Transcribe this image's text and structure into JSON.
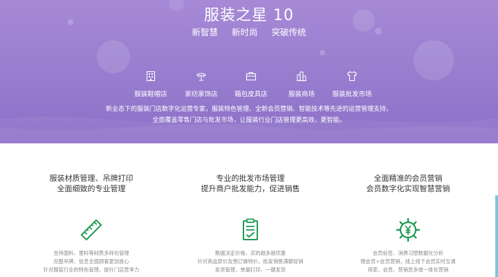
{
  "hero": {
    "title": "服装之星 10",
    "subtitle": [
      "新智慧",
      "新时尚",
      "突破传统"
    ],
    "stores": [
      {
        "label": "服装鞋帽店",
        "icon": "building-icon"
      },
      {
        "label": "家纺家饰店",
        "icon": "lamp-icon"
      },
      {
        "label": "箱包皮具店",
        "icon": "briefcase-icon"
      },
      {
        "label": "服装商场",
        "icon": "mall-icon"
      },
      {
        "label": "服装批发市场",
        "icon": "tshirt-icon"
      }
    ],
    "description": [
      "新业态下的服装门店数字化运营专家，服装特色管理、全新会员营销、智能技术等先进的运营管理支持，",
      "全面覆盖零售门店与批发市场，让服装行业门店管理更高效、更智能。"
    ]
  },
  "features": [
    {
      "title": [
        "服装材质管理、吊牌打印",
        "全面细致的专业管理"
      ],
      "icon": "ruler-icon",
      "desc": [
        "支持面料、里料等材质多样化管理",
        "完整吊牌，信息全面顾客更加放心",
        "针对服装行业的特色管理，提升门店竞争力"
      ]
    },
    {
      "title": [
        "专业的批发市场管理",
        "提升商户批发能力，促进销售"
      ],
      "icon": "document-icon",
      "desc": [
        "数据决定价格，买的越多越优惠",
        "针对商品原价及预订做特价，批发销售满额促销",
        "发货管理、单据打印、一键发货"
      ]
    },
    {
      "title": [
        "全面精准的会员营销",
        "会员数字化实现智慧营销"
      ],
      "icon": "yuan-gear-icon",
      "desc": [
        "会员标签、消费习惯数据化分析",
        "微会员+会员营销，线上线下会员实时互通",
        "商家、会员、营销员多维一体化营销"
      ]
    }
  ],
  "colors": {
    "hero_top": "#a689d6",
    "hero_bottom": "#8c6fc7",
    "accent_green": "#1f9a52",
    "scroll_tab": "#7ac6df"
  }
}
